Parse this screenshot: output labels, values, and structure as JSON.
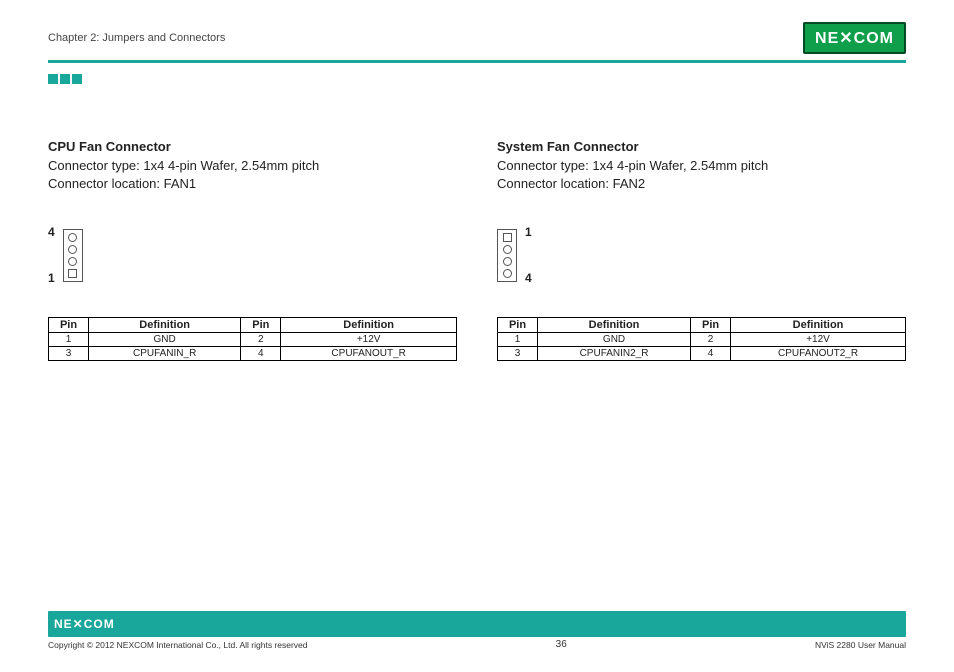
{
  "header": {
    "chapter": "Chapter 2: Jumpers and Connectors",
    "logo_text": "NE COM"
  },
  "left": {
    "title": "CPU Fan Connector",
    "type_line": "Connector type: 1x4 4-pin Wafer, 2.54mm pitch",
    "loc_line": "Connector location: FAN1",
    "pin_top_label": "4",
    "pin_bottom_label": "1",
    "table_header": {
      "pin": "Pin",
      "def": "Definition"
    },
    "rows": [
      {
        "p1": "1",
        "d1": "GND",
        "p2": "2",
        "d2": "+12V"
      },
      {
        "p1": "3",
        "d1": "CPUFANIN_R",
        "p2": "4",
        "d2": "CPUFANOUT_R"
      }
    ]
  },
  "right": {
    "title": "System Fan Connector",
    "type_line": "Connector type: 1x4 4-pin Wafer, 2.54mm pitch",
    "loc_line": "Connector location: FAN2",
    "pin_top_label": "1",
    "pin_bottom_label": "4",
    "table_header": {
      "pin": "Pin",
      "def": "Definition"
    },
    "rows": [
      {
        "p1": "1",
        "d1": "GND",
        "p2": "2",
        "d2": "+12V"
      },
      {
        "p1": "3",
        "d1": "CPUFANIN2_R",
        "p2": "4",
        "d2": "CPUFANOUT2_R"
      }
    ]
  },
  "footer": {
    "logo_text": "NE COM",
    "copyright": "Copyright © 2012 NEXCOM International Co., Ltd. All rights reserved",
    "page_num": "36",
    "doc_ref": "NViS 2280 User Manual"
  }
}
